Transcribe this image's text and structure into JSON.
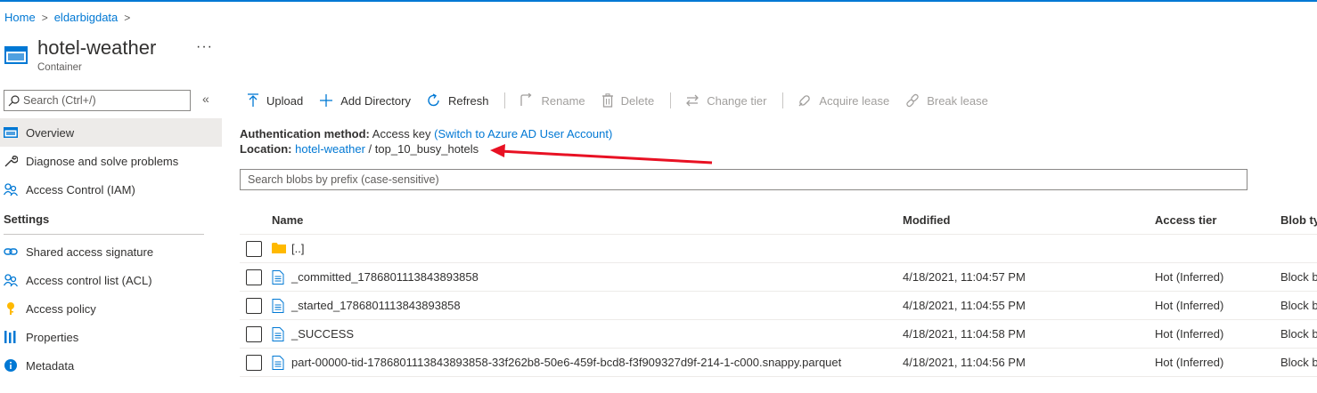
{
  "breadcrumb": {
    "home": "Home",
    "account": "eldarbigdata",
    "separator": ">"
  },
  "header": {
    "title": "hotel-weather",
    "subtitle": "Container",
    "more": "···"
  },
  "sidebar": {
    "search_placeholder": "Search (Ctrl+/)",
    "collapse": "«",
    "items": [
      {
        "label": "Overview",
        "icon": "container-icon",
        "active": true
      },
      {
        "label": "Diagnose and solve problems",
        "icon": "wrench-icon"
      },
      {
        "label": "Access Control (IAM)",
        "icon": "people-icon"
      }
    ],
    "settings_heading": "Settings",
    "settings_items": [
      {
        "label": "Shared access signature",
        "icon": "link-icon"
      },
      {
        "label": "Access control list (ACL)",
        "icon": "people-icon"
      },
      {
        "label": "Access policy",
        "icon": "key-icon"
      },
      {
        "label": "Properties",
        "icon": "properties-icon"
      },
      {
        "label": "Metadata",
        "icon": "info-icon"
      }
    ]
  },
  "toolbar": {
    "upload": "Upload",
    "add_directory": "Add Directory",
    "refresh": "Refresh",
    "rename": "Rename",
    "delete": "Delete",
    "change_tier": "Change tier",
    "acquire_lease": "Acquire lease",
    "break_lease": "Break lease"
  },
  "auth": {
    "label": "Authentication method:",
    "value": "Access key",
    "switch_link": "(Switch to Azure AD User Account)"
  },
  "location": {
    "label": "Location:",
    "container_link": "hotel-weather",
    "separator": "/",
    "folder": "top_10_busy_hotels"
  },
  "blob_search": {
    "placeholder": "Search blobs by prefix (case-sensitive)"
  },
  "table": {
    "headers": {
      "name": "Name",
      "modified": "Modified",
      "access_tier": "Access tier",
      "blob_type": "Blob ty"
    },
    "rows": [
      {
        "name": "[..]",
        "type": "folder",
        "modified": "",
        "tier": "",
        "blob_type": ""
      },
      {
        "name": "_committed_1786801113843893858",
        "type": "file",
        "modified": "4/18/2021, 11:04:57 PM",
        "tier": "Hot (Inferred)",
        "blob_type": "Block b"
      },
      {
        "name": "_started_1786801113843893858",
        "type": "file",
        "modified": "4/18/2021, 11:04:55 PM",
        "tier": "Hot (Inferred)",
        "blob_type": "Block b"
      },
      {
        "name": "_SUCCESS",
        "type": "file",
        "modified": "4/18/2021, 11:04:58 PM",
        "tier": "Hot (Inferred)",
        "blob_type": "Block b"
      },
      {
        "name": "part-00000-tid-1786801113843893858-33f262b8-50e6-459f-bcd8-f3f909327d9f-214-1-c000.snappy.parquet",
        "type": "file",
        "modified": "4/18/2021, 11:04:56 PM",
        "tier": "Hot (Inferred)",
        "blob_type": "Block b"
      }
    ]
  },
  "colors": {
    "accent": "#0078d4",
    "arrow": "#e81123",
    "folder": "#ffb900",
    "disabled": "#a19f9d"
  }
}
